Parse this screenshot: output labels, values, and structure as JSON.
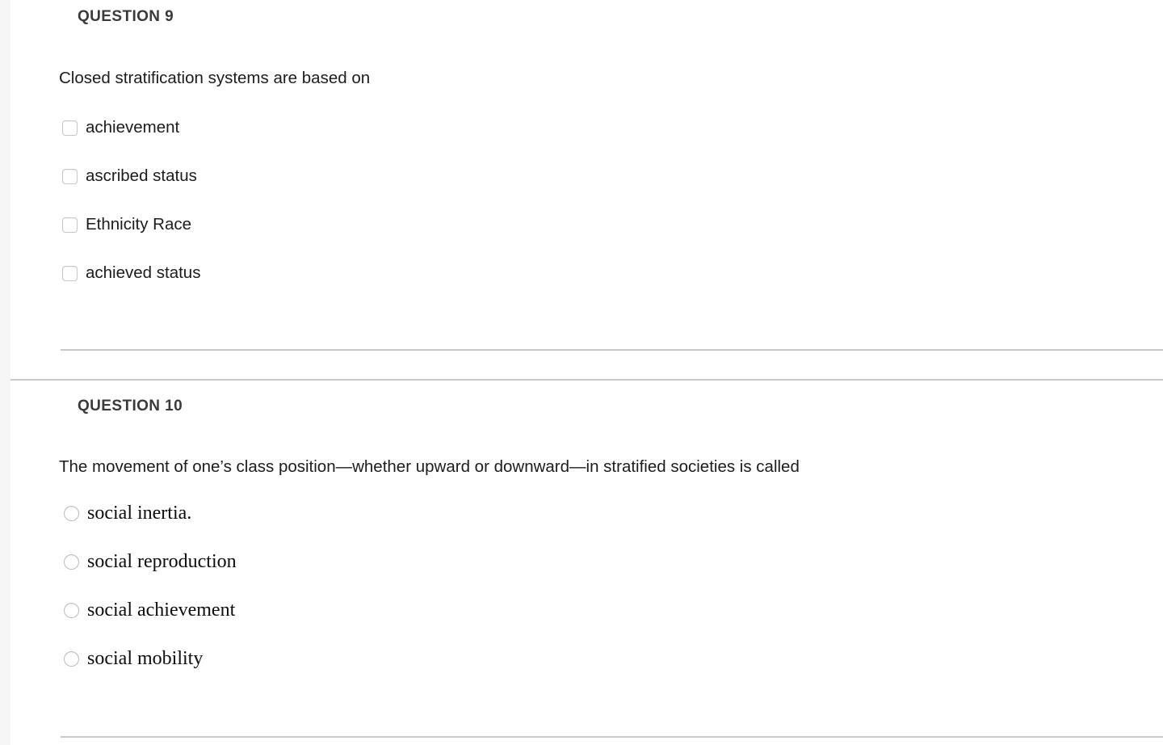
{
  "page": {
    "background_color": "#ffffff",
    "gutter_color": "#f6f6f6",
    "divider_color": "#c9c9c9"
  },
  "questions": [
    {
      "heading": "QUESTION 9",
      "prompt": "Closed stratification systems are based on",
      "control_type": "checkbox",
      "options": [
        {
          "label": "achievement",
          "checked": false
        },
        {
          "label": "ascribed status",
          "checked": false
        },
        {
          "label": "Ethnicity Race",
          "checked": false
        },
        {
          "label": "achieved status",
          "checked": false
        }
      ]
    },
    {
      "heading": "QUESTION 10",
      "prompt": "The movement of one’s class position—whether upward or downward—in stratified societies is called",
      "control_type": "radio",
      "options": [
        {
          "label": "social inertia.",
          "selected": false
        },
        {
          "label": "social reproduction",
          "selected": false
        },
        {
          "label": "social achievement",
          "selected": false
        },
        {
          "label": "social mobility",
          "selected": false
        }
      ]
    }
  ]
}
